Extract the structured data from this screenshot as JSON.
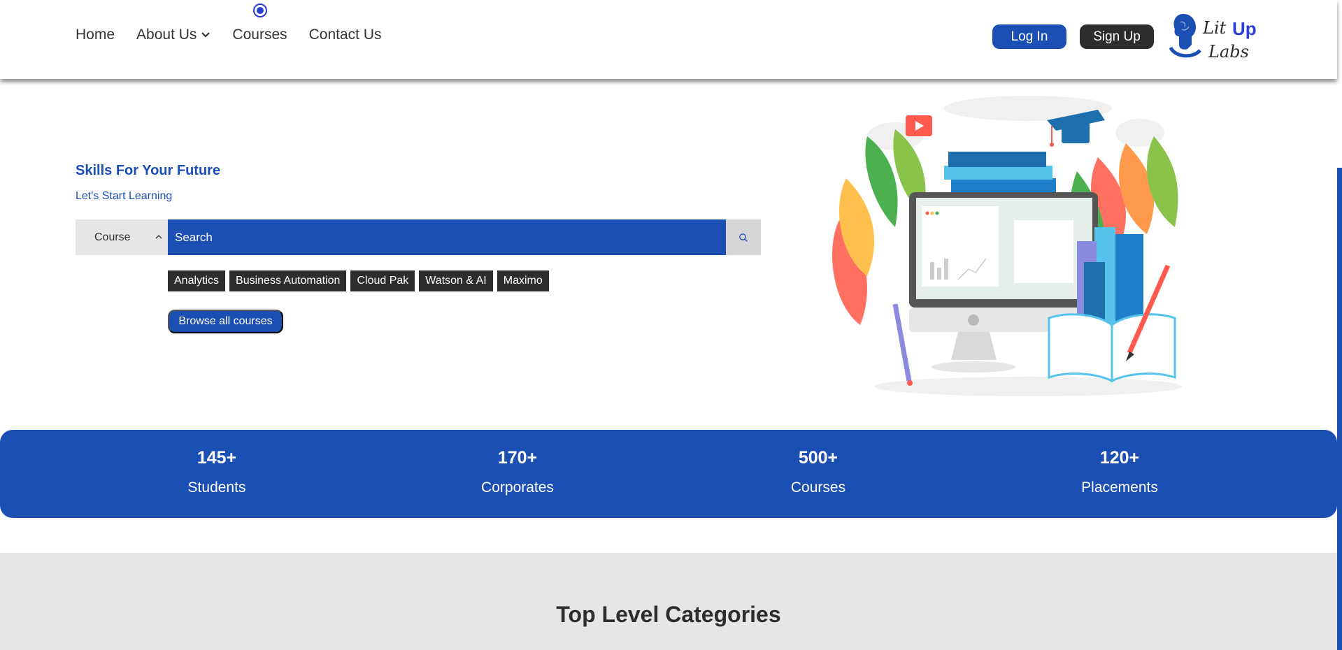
{
  "nav": {
    "items": [
      {
        "label": "Home"
      },
      {
        "label": "About Us"
      },
      {
        "label": "Courses"
      },
      {
        "label": "Contact Us"
      }
    ]
  },
  "auth": {
    "login_label": "Log In",
    "signup_label": "Sign Up"
  },
  "logo": {
    "text_top": "Lit",
    "text_accent": "Up",
    "text_bottom": "Labs"
  },
  "hero": {
    "title": "Skills For Your Future",
    "subtitle": "Let's Start Learning",
    "select_value": "Course",
    "search_placeholder": "Search",
    "tags": [
      "Analytics",
      "Business Automation",
      "Cloud Pak",
      "Watson & AI",
      "Maximo"
    ],
    "browse_label": "Browse all courses"
  },
  "stats": [
    {
      "value": "145+",
      "label": "Students"
    },
    {
      "value": "170+",
      "label": "Corporates"
    },
    {
      "value": "500+",
      "label": "Courses"
    },
    {
      "value": "120+",
      "label": "Placements"
    }
  ],
  "categories": {
    "title": "Top Level Categories"
  },
  "colors": {
    "primary": "#1c4fb4",
    "dark": "#2d2d2d",
    "light_gray": "#e6e6e6",
    "accent": "#2b3fd6"
  }
}
